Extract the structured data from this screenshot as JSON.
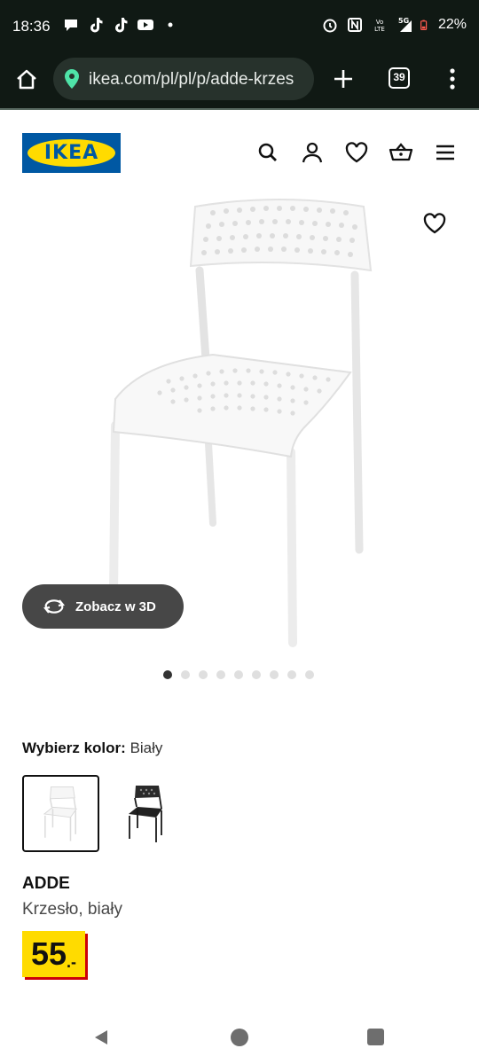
{
  "status_bar": {
    "time": "18:36",
    "battery": "22%",
    "left_icons": [
      "chat-bubble-icon",
      "tiktok-icon",
      "tiktok-icon",
      "youtube-icon",
      "dot-icon"
    ],
    "right_icons": [
      "alarm-icon",
      "nfc-icon",
      "volte-icon",
      "signal-5g-icon",
      "battery-icon"
    ],
    "network_label": "5G",
    "volte_label": "Vo LTE"
  },
  "browser": {
    "url": "ikea.com/pl/pl/p/adde-krzes",
    "tab_count": "39"
  },
  "header": {
    "logo_text": "IKEA",
    "icons": [
      "search-icon",
      "account-icon",
      "heart-icon",
      "basket-icon",
      "hamburger-menu-icon"
    ]
  },
  "gallery": {
    "view_3d_label": "Zobacz w 3D",
    "dot_count": 9,
    "active_dot": 0
  },
  "product": {
    "color_label": "Wybierz kolor:",
    "color_value": "Biały",
    "swatches": [
      "white",
      "black"
    ],
    "name": "ADDE",
    "description": "Krzesło, biały",
    "price_integer": "55",
    "price_decimal": ".-"
  },
  "colors": {
    "ikea_blue": "#0058a3",
    "ikea_yellow": "#ffdb00",
    "price_shadow": "#cc0008",
    "browser_bg": "#101914"
  }
}
